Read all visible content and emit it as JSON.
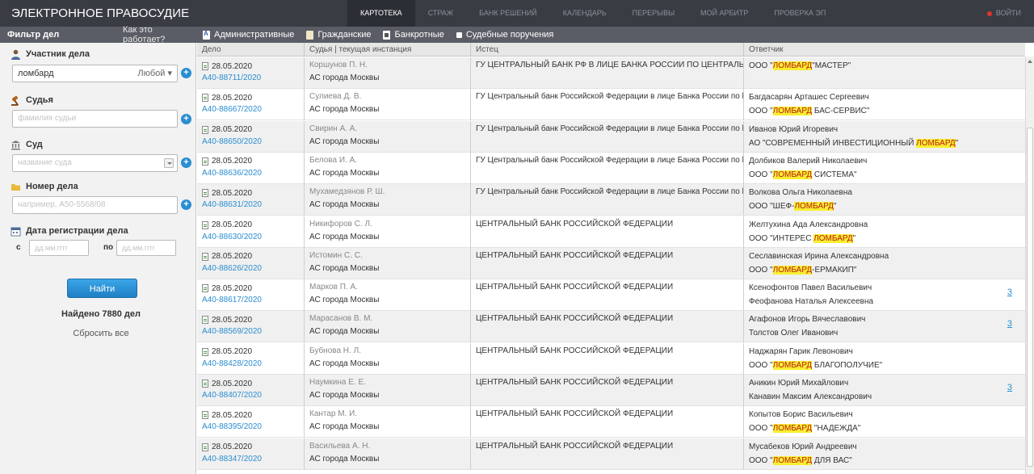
{
  "topbar": {
    "brand": "ЭЛЕКТРОННОЕ ПРАВОСУДИЕ",
    "nav": [
      "КАРТОТЕКА",
      "СТРАЖ",
      "БАНК РЕШЕНИЙ",
      "КАЛЕНДАРЬ",
      "ПЕРЕРЫВЫ",
      "МОЙ АРБИТР",
      "ПРОВЕРКА ЭП"
    ],
    "login": "ВОЙТИ"
  },
  "filterbar": {
    "title": "Фильтр дел",
    "how": "Как это работает?",
    "categories": [
      "Административные",
      "Гражданские",
      "Банкротные",
      "Судебные поручения"
    ]
  },
  "sidebar": {
    "participant_label": "Участник дела",
    "participant_value": "ломбард",
    "participant_role": "Любой",
    "judge_label": "Судья",
    "judge_placeholder": "фамилия судьи",
    "court_label": "Суд",
    "court_placeholder": "название суда",
    "case_label": "Номер дела",
    "case_placeholder": "например, А50-5568/08",
    "date_label": "Дата регистрации дела",
    "date_from": "с",
    "date_to": "по",
    "date_placeholder": "дд.мм.гггг",
    "find_button": "Найти",
    "found": "Найдено 7880 дел",
    "reset": "Сбросить все"
  },
  "table": {
    "headers": [
      "Дело",
      "Судья | текущая инстанция",
      "Истец",
      "Ответчик"
    ],
    "rows": [
      {
        "date": "28.05.2020",
        "case": "А40-88711/2020",
        "judge": "Коршунов П. Н.",
        "court": "АС города Москвы",
        "plaintiff": "ГУ ЦЕНТРАЛЬНЫЙ БАНК РФ В ЛИЦЕ БАНКА РОССИИ ПО ЦЕНТРАЛЬНС",
        "r1_pre": "ООО \"",
        "r1_hl": "ЛОМБАРД",
        "r1_post": "\"МАСТЕР\"",
        "r2_pre": "",
        "r2_hl": "",
        "r2_post": "",
        "more": ""
      },
      {
        "date": "28.05.2020",
        "case": "А40-88667/2020",
        "judge": "Сулиева Д. В.",
        "court": "АС города Москвы",
        "plaintiff": "ГУ Центральный банк Российской Федерации в лице Банка России по l",
        "r1_pre": "Багдасарян Арташес Сергеевич",
        "r1_hl": "",
        "r1_post": "",
        "r2_pre": "ООО \"",
        "r2_hl": "ЛОМБАРД",
        "r2_post": " БАС-СЕРВИС\"",
        "more": ""
      },
      {
        "date": "28.05.2020",
        "case": "А40-88650/2020",
        "judge": "Свирин А. А.",
        "court": "АС города Москвы",
        "plaintiff": "ГУ Центральный банк Российской Федерации в лице Банка России по l",
        "r1_pre": "Иванов Юрий Игоревич",
        "r1_hl": "",
        "r1_post": "",
        "r2_pre": "АО \"СОВРЕМЕННЫЙ ИНВЕСТИЦИОННЫЙ ",
        "r2_hl": "ЛОМБАРД",
        "r2_post": "\"",
        "more": ""
      },
      {
        "date": "28.05.2020",
        "case": "А40-88636/2020",
        "judge": "Белова И. А.",
        "court": "АС города Москвы",
        "plaintiff": "ГУ Центральный банк Российской Федерации в лице Банка России по l",
        "r1_pre": "Долбиков Валерий Николаевич",
        "r1_hl": "",
        "r1_post": "",
        "r2_pre": "ООО \"",
        "r2_hl": "ЛОМБАРД",
        "r2_post": " СИСТЕМА\"",
        "more": ""
      },
      {
        "date": "28.05.2020",
        "case": "А40-88631/2020",
        "judge": "Мухамедзянов Р. Ш.",
        "court": "АС города Москвы",
        "plaintiff": "ГУ Центральный банк Российской Федерации в лице Банка России по l",
        "r1_pre": "Волкова Ольга Николаевна",
        "r1_hl": "",
        "r1_post": "",
        "r2_pre": "ООО \"ШЕФ-",
        "r2_hl": "ЛОМБАРД",
        "r2_post": "\"",
        "more": ""
      },
      {
        "date": "28.05.2020",
        "case": "А40-88630/2020",
        "judge": "Никифоров С. Л.",
        "court": "АС города Москвы",
        "plaintiff": "ЦЕНТРАЛЬНЫЙ БАНК РОССИЙСКОЙ ФЕДЕРАЦИИ",
        "r1_pre": "Желтухина Ада Александровна",
        "r1_hl": "",
        "r1_post": "",
        "r2_pre": "ООО \"ИНТЕРЕС ",
        "r2_hl": "ЛОМБАРД",
        "r2_post": "\"",
        "more": ""
      },
      {
        "date": "28.05.2020",
        "case": "А40-88626/2020",
        "judge": "Истомин С. С.",
        "court": "АС города Москвы",
        "plaintiff": "ЦЕНТРАЛЬНЫЙ БАНК РОССИЙСКОЙ ФЕДЕРАЦИИ",
        "r1_pre": "Сеславинская Ирина Александровна",
        "r1_hl": "",
        "r1_post": "",
        "r2_pre": "ООО \"",
        "r2_hl": "ЛОМБАРД",
        "r2_post": "-ЕРМАКИП\"",
        "more": ""
      },
      {
        "date": "28.05.2020",
        "case": "А40-88617/2020",
        "judge": "Марков П. А.",
        "court": "АС города Москвы",
        "plaintiff": "ЦЕНТРАЛЬНЫЙ БАНК РОССИЙСКОЙ ФЕДЕРАЦИИ",
        "r1_pre": "Ксенофонтов Павел Васильевич",
        "r1_hl": "",
        "r1_post": "",
        "r2_pre": "Феофанова Наталья Алексеевна",
        "r2_hl": "",
        "r2_post": "",
        "more": "3"
      },
      {
        "date": "28.05.2020",
        "case": "А40-88569/2020",
        "judge": "Марасанов В. М.",
        "court": "АС города Москвы",
        "plaintiff": "ЦЕНТРАЛЬНЫЙ БАНК РОССИЙСКОЙ ФЕДЕРАЦИИ",
        "r1_pre": "Агафонов Игорь Вячеславович",
        "r1_hl": "",
        "r1_post": "",
        "r2_pre": "Толстов Олег Иванович",
        "r2_hl": "",
        "r2_post": "",
        "more": "3"
      },
      {
        "date": "28.05.2020",
        "case": "А40-88428/2020",
        "judge": "Бубнова Н. Л.",
        "court": "АС города Москвы",
        "plaintiff": "ЦЕНТРАЛЬНЫЙ БАНК РОССИЙСКОЙ ФЕДЕРАЦИИ",
        "r1_pre": "Наджарян Гарик Левонович",
        "r1_hl": "",
        "r1_post": "",
        "r2_pre": "ООО \"",
        "r2_hl": "ЛОМБАРД",
        "r2_post": " БЛАГОПОЛУЧИЕ\"",
        "more": ""
      },
      {
        "date": "28.05.2020",
        "case": "А40-88407/2020",
        "judge": "Наумкина Е. Е.",
        "court": "АС города Москвы",
        "plaintiff": "ЦЕНТРАЛЬНЫЙ БАНК РОССИЙСКОЙ ФЕДЕРАЦИИ",
        "r1_pre": "Аникин Юрий Михайлович",
        "r1_hl": "",
        "r1_post": "",
        "r2_pre": "Канавин Максим Александрович",
        "r2_hl": "",
        "r2_post": "",
        "more": "3"
      },
      {
        "date": "28.05.2020",
        "case": "А40-88395/2020",
        "judge": "Кантар М. И.",
        "court": "АС города Москвы",
        "plaintiff": "ЦЕНТРАЛЬНЫЙ БАНК РОССИЙСКОЙ ФЕДЕРАЦИИ",
        "r1_pre": "Копытов Борис Васильевич",
        "r1_hl": "",
        "r1_post": "",
        "r2_pre": "ООО \"",
        "r2_hl": "ЛОМБАРД",
        "r2_post": " \"НАДЕЖДА\"",
        "more": ""
      },
      {
        "date": "28.05.2020",
        "case": "А40-88347/2020",
        "judge": "Васильева А. Н.",
        "court": "АС города Москвы",
        "plaintiff": "ЦЕНТРАЛЬНЫЙ БАНК РОССИЙСКОЙ ФЕДЕРАЦИИ",
        "r1_pre": "Мусабеков Юрий Андреевич",
        "r1_hl": "",
        "r1_post": "",
        "r2_pre": "ООО \"",
        "r2_hl": "ЛОМБАРД",
        "r2_post": " ДЛЯ ВАС\"",
        "more": ""
      }
    ]
  },
  "colors": {
    "topbar": "#3a3c44",
    "filterbar": "#5a5d66",
    "link": "#2a8ed1",
    "highlight_bg": "#f7ef30",
    "highlight_text": "#c0171d"
  }
}
